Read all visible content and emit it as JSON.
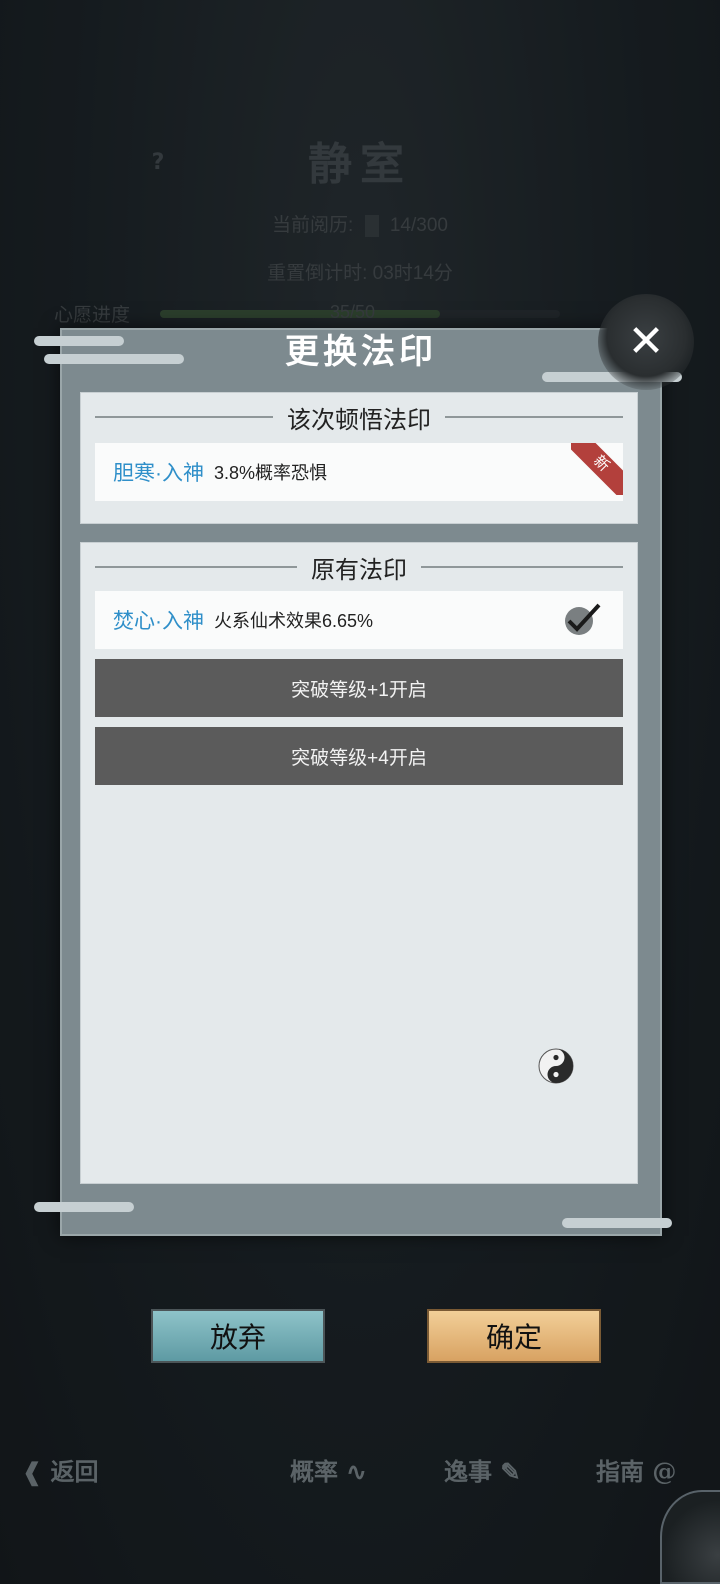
{
  "background": {
    "title": "静室",
    "help": "?",
    "experience_label": "当前阅历:",
    "experience_value": "14/300",
    "reset_label": "重置倒计时:",
    "reset_value": "03时14分",
    "wish_label": "心愿进度",
    "wish_value": "35/50",
    "wish_progress": 0.7
  },
  "dialog": {
    "title": "更换法印",
    "close_label": "✕",
    "new_section": {
      "heading": "该次顿悟法印",
      "seal": {
        "name": "胆寒·入神",
        "desc": "3.8%概率恐惧",
        "tag": "新"
      }
    },
    "old_section": {
      "heading": "原有法印",
      "seal": {
        "name": "焚心·入神",
        "desc": "火系仙术效果6.65%"
      },
      "locked_slots": [
        "突破等级+1开启",
        "突破等级+4开启"
      ]
    },
    "buttons": {
      "abandon": "放弃",
      "confirm": "确定"
    }
  },
  "bottom_nav": {
    "back": "返回",
    "probability": "概率",
    "anecdotes": "逸事",
    "guide": "指南"
  }
}
